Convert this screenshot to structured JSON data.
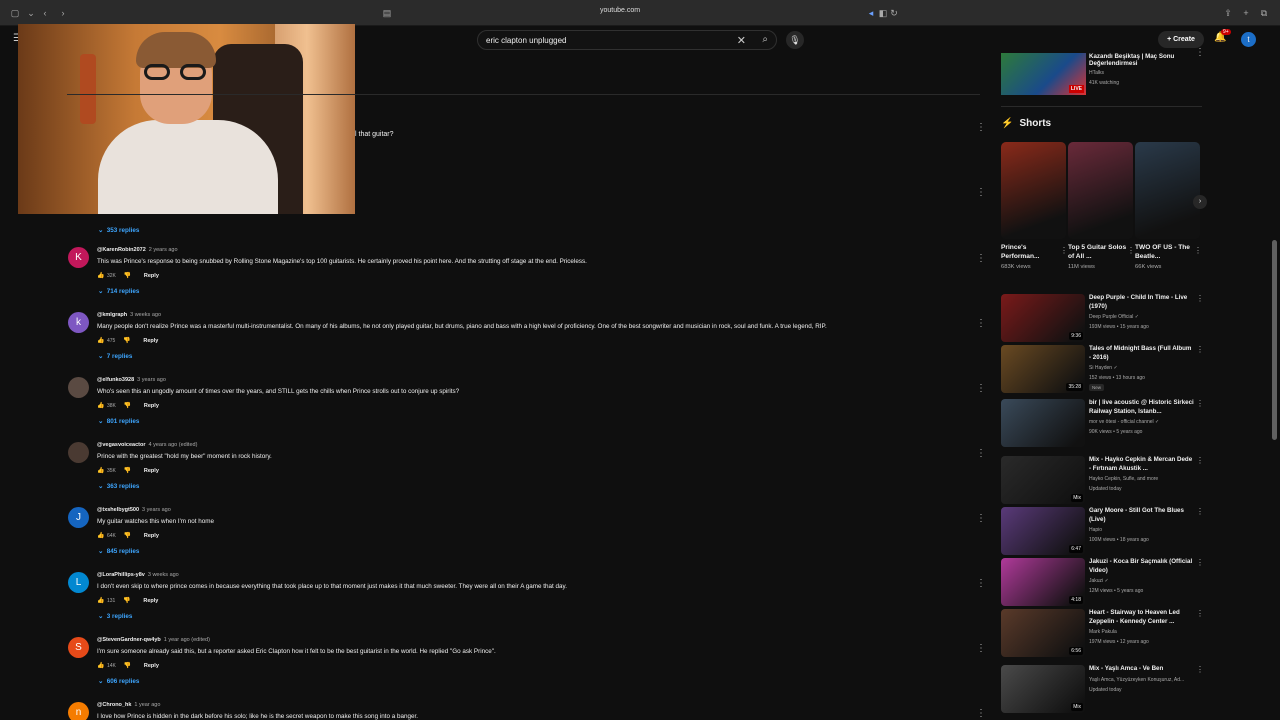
{
  "browser": {
    "url": "youtube.com"
  },
  "header": {
    "search_query": "eric clapton unplugged",
    "create_label": "Create",
    "notif_badge": "9+",
    "avatar_letter": "t"
  },
  "partial_comment_text": "l that guitar?",
  "first_replies": "353 replies",
  "comments": [
    {
      "avatar": "K",
      "color": "#c2185b",
      "handle": "@KarenRobin2072",
      "time": "2 years ago",
      "text": "This was Prince's response to being snubbed by Rolling Stone Magazine's top 100 guitarists. He certainly proved his point here. And the strutting off stage at the end. Priceless.",
      "likes": "32K",
      "replies": "714 replies"
    },
    {
      "avatar": "k",
      "color": "#7e57c2",
      "handle": "@kmlgraph",
      "time": "3 weeks ago",
      "text": "Many people don't realize Prince was a masterful multi-instrumentalist. On many of his albums, he not  only played guitar, but drums, piano and bass with a high level of proficiency. One of the best songwriter and musician in rock, soul and funk. A true legend, RIP.",
      "likes": "475",
      "replies": "7 replies"
    },
    {
      "avatar": "",
      "color": "#5a4a42",
      "handle": "@elfunko3928",
      "time": "3 years ago",
      "text": "Who's seen this an ungodly amount of times over the years, and STILL gets the chills when Prince strolls out to conjure up spirits?",
      "likes": "38K",
      "replies": "801 replies"
    },
    {
      "avatar": "",
      "color": "#4a3a32",
      "handle": "@vegasvoiceactor",
      "time": "4 years ago (edited)",
      "text": "Prince with the greatest \"hold my beer\" moment in rock history.",
      "likes": "35K",
      "replies": "363 replies"
    },
    {
      "avatar": "J",
      "color": "#1565c0",
      "handle": "@txshelbygt500",
      "time": "3 years ago",
      "text": "My guitar watches this when I'm not home",
      "likes": "64K",
      "replies": "845 replies"
    },
    {
      "avatar": "L",
      "color": "#0288d1",
      "handle": "@LoraPhillips-y8v",
      "time": "3 weeks ago",
      "text": "I don't even skip to where prince comes in because everything that took place up to that moment just makes it that much sweeter. They were all on their A game that day.",
      "likes": "131",
      "replies": "3 replies"
    },
    {
      "avatar": "S",
      "color": "#e64a19",
      "handle": "@StevenGardner-qw4yb",
      "time": "1 year ago (edited)",
      "text": "I'm sure someone already said this, but a reporter asked Eric Clapton how it felt to be the best guitarist in the world. He replied \"Go ask Prince\".",
      "likes": "14K",
      "replies": "606 replies"
    },
    {
      "avatar": "n",
      "color": "#f57c00",
      "handle": "@Chrono_hk",
      "time": "1 year ago",
      "text": "I love how Prince is hidden in the dark before his solo; like he is the secret weapon to make this song into a banger.",
      "likes": "",
      "replies": ""
    }
  ],
  "reply_label": "Reply",
  "sidebar": {
    "top_video": {
      "title": "Kazandı Beşiktaş | Maç Sonu Değerlendirmesi",
      "channel": "HTalks",
      "viewers": "41K watching",
      "live": "LIVE"
    },
    "shorts_title": "Shorts",
    "shorts": [
      {
        "title": "Prince's Performan...",
        "views": "683K views",
        "color": "#8a2a1a"
      },
      {
        "title": "Top 5 Guitar Solos of All ...",
        "views": "11M views",
        "color": "#6a2a3a"
      },
      {
        "title": "TWO OF US - The Beatle...",
        "views": "66K views",
        "color": "#2a3a4a"
      }
    ],
    "recommended": [
      {
        "title": "Deep Purple - Child In Time - Live (1970)",
        "channel": "Deep Purple Official ✓",
        "meta": "193M views • 15 years ago",
        "duration": "9:36",
        "color": "#7a1a1a",
        "badge": ""
      },
      {
        "title": "Tales of Midnight Bass (Full Album - 2016)",
        "channel": "Si Hayden ✓",
        "meta": "152 views • 13 hours ago",
        "duration": "35:28",
        "color": "#6a4a22",
        "badge": "New"
      },
      {
        "title": "bir | live acoustic @ Historic Sirkeci Railway Station, Istanb...",
        "channel": "mor ve ötesi - official channel ✓",
        "meta": "90K views • 5 years ago",
        "duration": "",
        "color": "#3a4a5a",
        "badge": ""
      },
      {
        "title": "Mix - Hayko Cepkin & Mercan Dede - Fırtınam Akustik ...",
        "channel": "Hayko Cepkin, Sufle, and more",
        "meta": "Updated today",
        "duration": "Mix",
        "color": "#2a2a2a",
        "badge": ""
      },
      {
        "title": "Gary Moore - Still Got The Blues (Live)",
        "channel": "Hapio",
        "meta": "100M views • 18 years ago",
        "duration": "6:47",
        "color": "#5a3a7a",
        "badge": ""
      },
      {
        "title": "Jakuzi - Koca Bir Saçmalık (Official Video)",
        "channel": "Jakuzi ✓",
        "meta": "12M views • 5 years ago",
        "duration": "4:18",
        "color": "#b03a9a",
        "badge": ""
      },
      {
        "title": "Heart - Stairway to Heaven Led Zeppelin - Kennedy Center ...",
        "channel": "Mark Pakula",
        "meta": "197M views • 12 years ago",
        "duration": "6:56",
        "color": "#5a3a2a",
        "badge": ""
      },
      {
        "title": "Mix - Yaşlı Amca - Ve Ben",
        "channel": "Yaşlı Amca, Yüzyüzeyken Konuşuruz, Ad...",
        "meta": "Updated today",
        "duration": "Mix",
        "color": "#4a4a4a",
        "badge": ""
      }
    ]
  }
}
